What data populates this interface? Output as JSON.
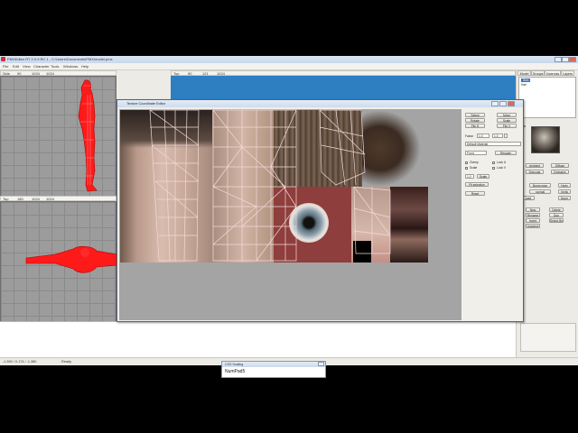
{
  "window": {
    "title": "PMXEditor RT 2.0.9 RC 1 - C:\\Users\\Documents\\PMX\\model.pmx",
    "minimize_label": "_",
    "maximize_label": "□",
    "close_label": "x"
  },
  "menu": [
    "File",
    "Edit",
    "View",
    "Character",
    "Tools",
    "Windows",
    "Help"
  ],
  "viewports": {
    "left_top_mode": "Side",
    "left_top_a": "90",
    "left_top_b": "1024",
    "left_top_c": "1024",
    "center_mode": "Top",
    "center_a": "90",
    "center_b": "121",
    "center_c": "1024",
    "left_bottom_mode": "Top",
    "left_bottom_a": "180",
    "left_bottom_b": "1024",
    "left_bottom_c": "1024"
  },
  "right_panel": {
    "tabs": [
      "Model",
      "Groups",
      "Materials",
      "Layers"
    ],
    "active_tab": "Materials",
    "list_items": [
      "Skin",
      "Hair"
    ],
    "section_label": "Maps",
    "buttons": [
      [
        "Ambient",
        "Diffuse"
      ],
      [
        "Specular",
        "Emissive"
      ],
      [
        "Bump map",
        "Horiz"
      ],
      [
        "normal",
        "Vertic"
      ],
      [
        "load",
        "None"
      ],
      [
        "New",
        "Delete"
      ],
      [
        "Rename",
        "Dup"
      ],
      [
        "Invert",
        "Select By"
      ],
      [
        "Unselect",
        ""
      ]
    ]
  },
  "dialog": {
    "title": "Texture Coordinate Editor",
    "buttons": {
      "select": "Select",
      "move": "Move",
      "rotate": "Rotate",
      "scale": "Scale",
      "flip_h": "Flip H",
      "flip_v": "Flip V",
      "factor_label": "Factor",
      "factor_value": "1.0",
      "factor_step": "1.0",
      "front": "Front",
      "rescale": "Rescale",
      "clamp_label": "Clamp",
      "lock_u_label": "Lock U",
      "scale_lbl": "Scale",
      "lock_v_label": "Lock V",
      "value_10": "1.0",
      "scale_btn": "Scale",
      "fit_selection": "Fit selection",
      "reset": "Reset"
    },
    "dropdown": "Default Material"
  },
  "status_bar": {
    "coords": "-1.390 / 0.174 / -1.380",
    "state": "Ready"
  },
  "popup": {
    "title": "CSS Scaling",
    "value": "NumPad5"
  },
  "colors": {
    "viewport_grid": "#9c9c9c",
    "blue_viewport": "#2d7fc2",
    "model_red": "#ff1a1a",
    "uv_wire": "#f4d9d9"
  }
}
